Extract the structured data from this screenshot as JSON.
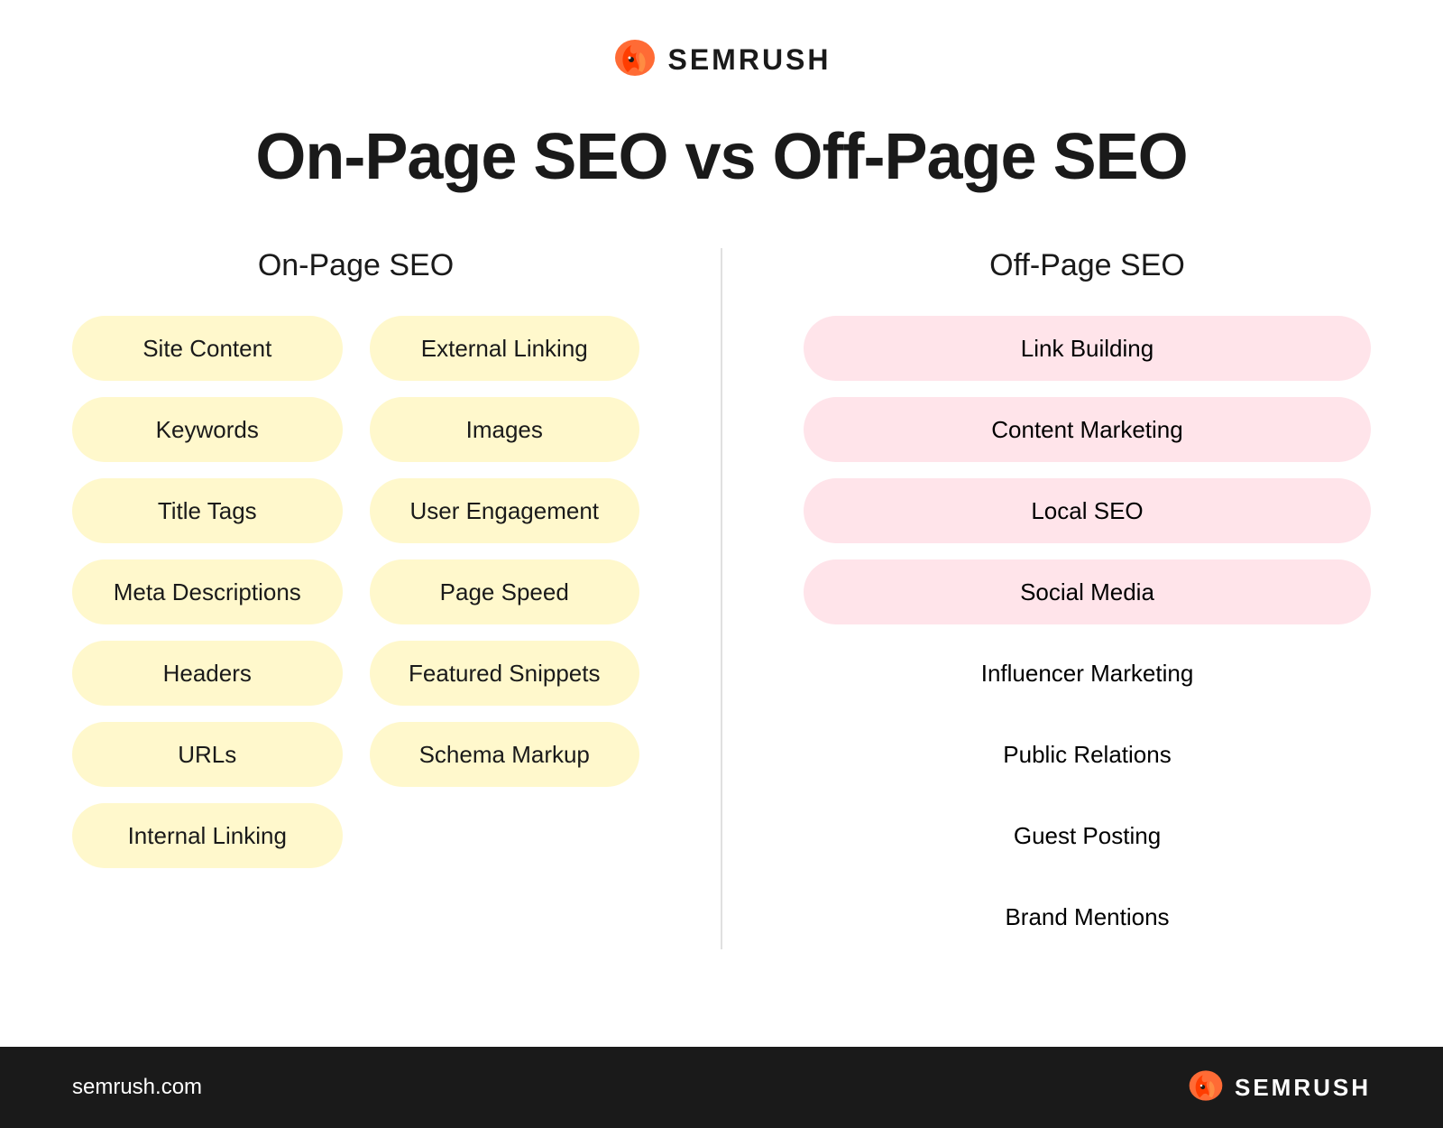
{
  "header": {
    "logo_text": "SEMRUSH",
    "title": "On-Page SEO vs Off-Page SEO"
  },
  "on_page": {
    "column_title": "On-Page SEO",
    "left_items": [
      "Site Content",
      "Keywords",
      "Title Tags",
      "Meta Descriptions",
      "Headers",
      "URLs",
      "Internal Linking"
    ],
    "right_items": [
      "External Linking",
      "Images",
      "User Engagement",
      "Page Speed",
      "Featured Snippets",
      "Schema Markup"
    ]
  },
  "off_page": {
    "column_title": "Off-Page SEO",
    "items": [
      {
        "label": "Link Building",
        "has_bg": true
      },
      {
        "label": "Content Marketing",
        "has_bg": true
      },
      {
        "label": "Local SEO",
        "has_bg": true
      },
      {
        "label": "Social Media",
        "has_bg": true
      },
      {
        "label": "Influencer Marketing",
        "has_bg": false
      },
      {
        "label": "Public Relations",
        "has_bg": false
      },
      {
        "label": "Guest Posting",
        "has_bg": false
      },
      {
        "label": "Brand Mentions",
        "has_bg": false
      }
    ]
  },
  "footer": {
    "url": "semrush.com",
    "logo_text": "SEMRUSH"
  }
}
